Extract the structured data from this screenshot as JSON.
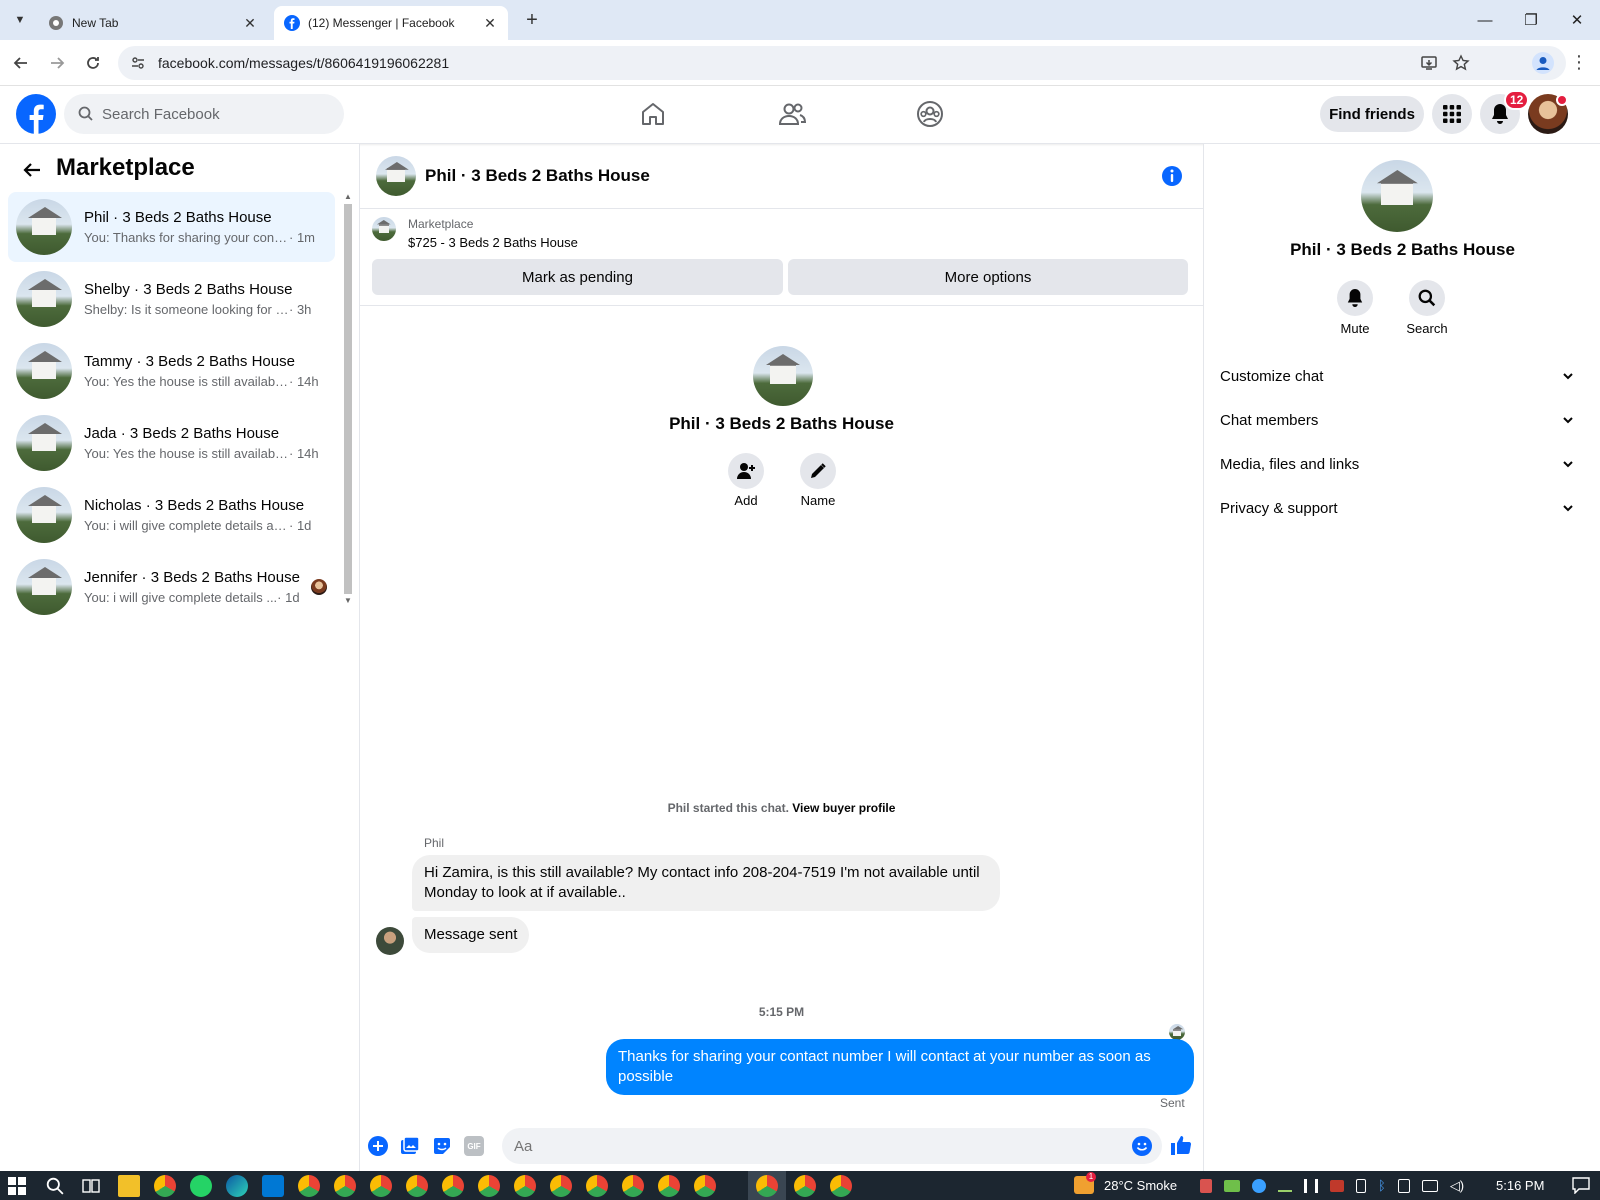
{
  "browser": {
    "tabs": [
      {
        "title": "New Tab",
        "active": false
      },
      {
        "title": "(12) Messenger | Facebook",
        "active": true
      }
    ],
    "url": "facebook.com/messages/t/8606419196062281"
  },
  "fb": {
    "search_placeholder": "Search Facebook",
    "find_friends": "Find friends",
    "notif_count": "12"
  },
  "left": {
    "title": "Marketplace",
    "conversations": [
      {
        "name": "Phil · 3 Beds 2 Baths House",
        "snippet": "You: Thanks for sharing your conta...",
        "time": " · 1m",
        "selected": true
      },
      {
        "name": "Shelby · 3 Beds 2 Baths House",
        "snippet": "Shelby: Is it someone looking for a ...",
        "time": " · 3h",
        "selected": false
      },
      {
        "name": "Tammy · 3 Beds 2 Baths House",
        "snippet": "You: Yes the house is still available...",
        "time": " · 14h",
        "selected": false
      },
      {
        "name": "Jada · 3 Beds 2 Baths House",
        "snippet": "You: Yes the house is still available...",
        "time": " · 14h",
        "selected": false
      },
      {
        "name": "Nicholas · 3 Beds 2 Baths House",
        "snippet": "You: i will give complete details as ...",
        "time": " · 1d",
        "selected": false
      },
      {
        "name": "Jennifer · 3 Beds 2 Baths House",
        "snippet": "You: i will give complete details ...",
        "time": " · 1d",
        "selected": false
      }
    ]
  },
  "chat": {
    "title": "Phil · 3 Beds 2 Baths House",
    "listing_source": "Marketplace",
    "listing_title": "$725 - 3 Beds 2 Baths House",
    "mark_pending": "Mark as pending",
    "more_options": "More options",
    "profile_name": "Phil · 3 Beds 2 Baths House",
    "add_label": "Add",
    "name_label": "Name",
    "started_text": "Phil started this chat.",
    "view_profile": "View buyer profile",
    "sender_name": "Phil",
    "msg1": "Hi Zamira, is this still available? My contact info 208-204-7519 I'm not available until Monday to look at if available..",
    "msg2": "Message sent",
    "timestamp": "5:15 PM",
    "msg3": "Thanks for sharing your contact number I will contact at your number as soon as possible",
    "sent_status": "Sent",
    "input_placeholder": "Aa",
    "gif_label": "GIF"
  },
  "right": {
    "name": "Phil · 3 Beds 2 Baths House",
    "mute": "Mute",
    "search": "Search",
    "sections": [
      "Customize chat",
      "Chat members",
      "Media, files and links",
      "Privacy & support"
    ]
  },
  "taskbar": {
    "weather": "28°C  Smoke",
    "time": "5:16 PM",
    "weather_badge": "1"
  },
  "colors": {
    "fb_blue": "#0866ff",
    "messenger_blue": "#0084ff",
    "selected_bg": "#ebf5ff",
    "notif_red": "#e41e3f"
  }
}
